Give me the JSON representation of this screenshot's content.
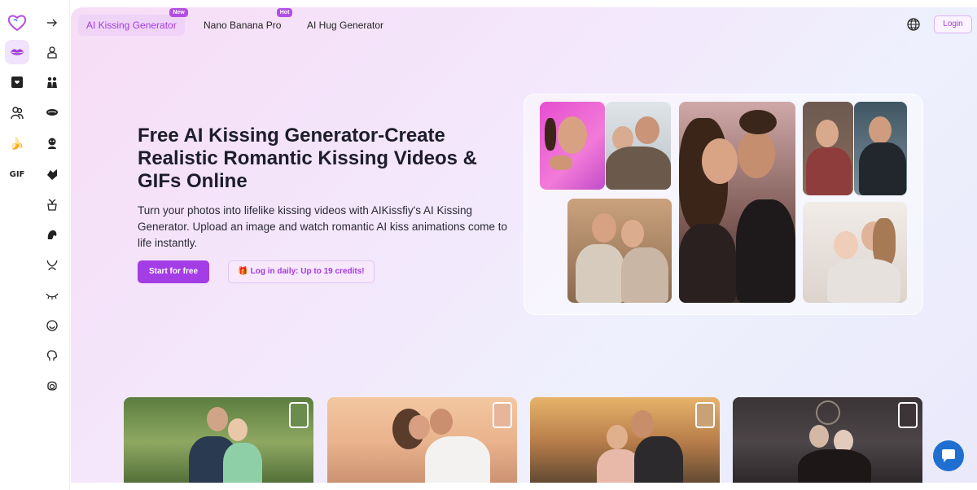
{
  "sidebar": {
    "gif_label": "GIF"
  },
  "topbar": {
    "tabs": [
      {
        "label": "AI Kissing Generator",
        "badge": "New"
      },
      {
        "label": "Nano Banana Pro",
        "badge": "Hot"
      },
      {
        "label": "AI Hug Generator",
        "badge": ""
      }
    ],
    "login_label": "Login"
  },
  "hero": {
    "title": "Free AI Kissing Generator-Create Realistic Romantic Kissing Videos & GIFs Online",
    "description": "Turn your photos into lifelike kissing videos with AIKissfiy's AI Kissing Generator. Upload an image and watch romantic AI kiss animations come to life instantly.",
    "start_label": "Start for free",
    "daily_label": "🎁 Log in daily: Up to 19 credits!"
  },
  "colors": {
    "accent": "#a43de6",
    "accent_light": "#f0d4f8",
    "chat_button": "#1e6fd0"
  }
}
